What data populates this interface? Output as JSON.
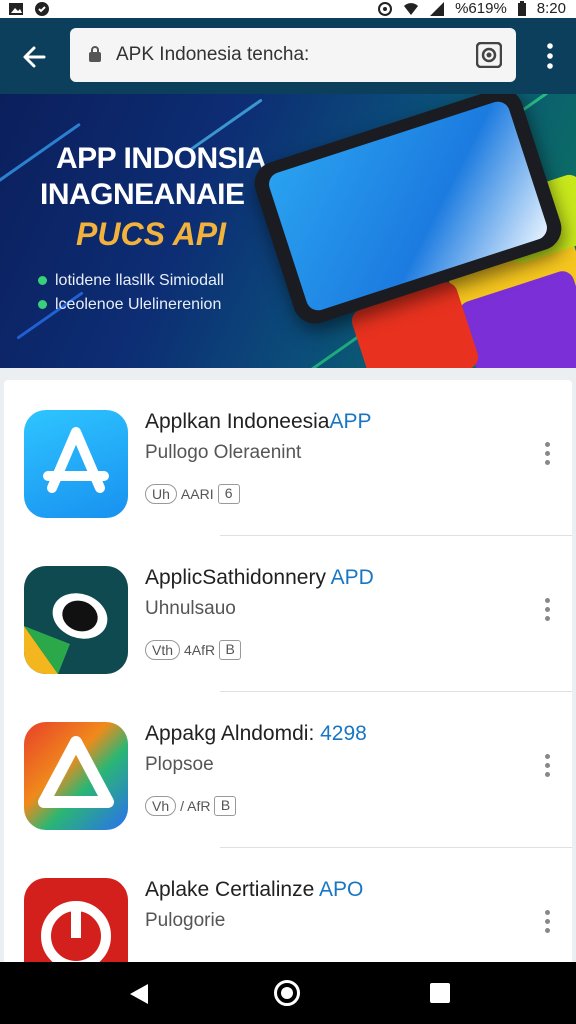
{
  "status_bar": {
    "battery": "%619%",
    "time": "8:20"
  },
  "toolbar": {
    "url": "APK Indonesia tencha:",
    "back_icon": "arrow-left-icon",
    "camera_icon": "camera-icon",
    "menu_icon": "more-vert-icon"
  },
  "banner": {
    "title": "APP INDONSIA",
    "subtitle1": "INAGNEANAIE",
    "subtitle2": "PUCS API",
    "bullet1": "lotidene llasllk Simiodall",
    "bullet2": "lceolenoe Ulelinerenion"
  },
  "apps": [
    {
      "name": "Applkan Indoneesia",
      "tag": "APP",
      "developer": "Pullogo Oleraenint",
      "badge": "Uh",
      "badge_text": "AARI",
      "box": "6"
    },
    {
      "name": "ApplicSathidonnery",
      "tag": " APD",
      "developer": "Uhnulsauo",
      "badge": "Vth",
      "badge_text": "4AfR",
      "box": "B"
    },
    {
      "name": "Appakg Alndomdi:",
      "tag": " 4298",
      "developer": "Plopsoe",
      "badge": "Vh",
      "badge_text": "/ AfR",
      "box": "B"
    },
    {
      "name": "Aplake Certialinze",
      "tag": " APO",
      "developer": "Pulogorie",
      "badge": "",
      "badge_text": "",
      "box": ""
    }
  ],
  "colors": {
    "toolbar": "#0c3f5c",
    "accent": "#1876c4",
    "banner_accent": "#f2b23c"
  },
  "nav": {
    "back_icon": "nav-back-icon",
    "home_icon": "nav-home-icon",
    "recents_icon": "nav-recents-icon"
  }
}
